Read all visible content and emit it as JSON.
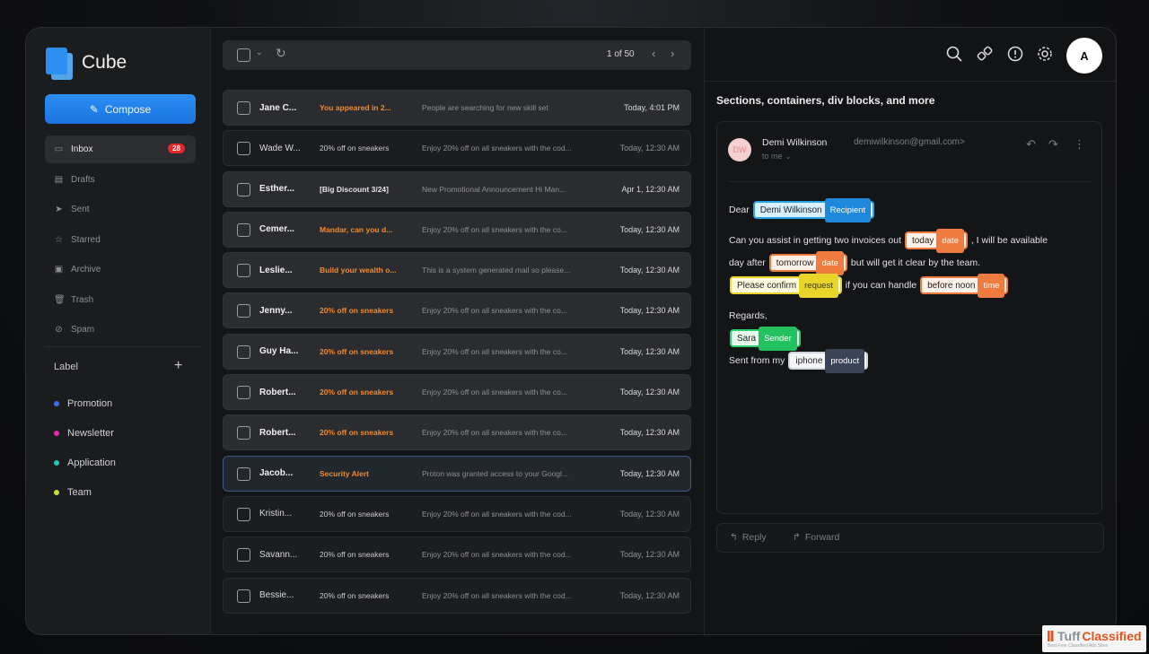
{
  "brand": {
    "name": "Cube"
  },
  "compose": {
    "label": "Compose",
    "icon": "pencil-icon"
  },
  "nav": [
    {
      "label": "Inbox",
      "icon": "inbox-icon",
      "badge": "28",
      "active": true
    },
    {
      "label": "Drafts",
      "icon": "draft-icon"
    },
    {
      "label": "Sent",
      "icon": "send-icon"
    },
    {
      "label": "Starred",
      "icon": "star-icon"
    },
    {
      "label": "Archive",
      "icon": "archive-icon"
    },
    {
      "label": "Trash",
      "icon": "trash-icon"
    },
    {
      "label": "Spam",
      "icon": "spam-icon"
    }
  ],
  "labels_section": {
    "title": "Label",
    "add": "+"
  },
  "labels": [
    {
      "label": "Promotion",
      "color": "#3b6cf0"
    },
    {
      "label": "Newsletter",
      "color": "#e52bb2"
    },
    {
      "label": "Application",
      "color": "#1fc9c0"
    },
    {
      "label": "Team",
      "color": "#c8e02b"
    }
  ],
  "toolbar": {
    "page": "1 of 50",
    "prev": "‹",
    "next": "›"
  },
  "emails": [
    {
      "from": "Jane C...",
      "subject": "You appeared in 2...",
      "preview": "People are searching for new skill set",
      "time": "Today, 4:01 PM",
      "unread": true,
      "orange": true
    },
    {
      "from": "Wade W...",
      "subject": "20% off on sneakers",
      "preview": "Enjoy 20% off on all sneakers with the cod...",
      "time": "Today, 12:30 AM",
      "unread": false,
      "orange": false
    },
    {
      "from": "Esther...",
      "subject": "[Big Discount 3/24]",
      "preview": "New Promotional Announcement Hi Man...",
      "time": "Apr 1, 12:30 AM",
      "unread": true,
      "orange": false
    },
    {
      "from": "Cemer...",
      "subject": "Mandar, can you d...",
      "preview": "Enjoy 20% off on all sneakers with the co...",
      "time": "Today, 12:30 AM",
      "unread": true,
      "orange": true
    },
    {
      "from": "Leslie...",
      "subject": "Build your wealth o...",
      "preview": "This is a system generated mail so please...",
      "time": "Today, 12:30 AM",
      "unread": true,
      "orange": true
    },
    {
      "from": "Jenny...",
      "subject": "20% off on sneakers",
      "preview": "Enjoy 20% off on all sneakers with the co...",
      "time": "Today, 12:30 AM",
      "unread": true,
      "orange": true
    },
    {
      "from": "Guy Ha...",
      "subject": "20% off on sneakers",
      "preview": "Enjoy 20% off on all sneakers with the co...",
      "time": "Today, 12:30 AM",
      "unread": true,
      "orange": true
    },
    {
      "from": "Robert...",
      "subject": "20% off on sneakers",
      "preview": "Enjoy 20% off on all sneakers with the co...",
      "time": "Today, 12:30 AM",
      "unread": true,
      "orange": true
    },
    {
      "from": "Robert...",
      "subject": "20% off on sneakers",
      "preview": "Enjoy 20% off on all sneakers with the co...",
      "time": "Today, 12:30 AM",
      "unread": true,
      "orange": true
    },
    {
      "from": "Jacob...",
      "subject": "Security Alert",
      "preview": "Proton was granted access to your Googl...",
      "time": "Today, 12:30 AM",
      "unread": true,
      "orange": true,
      "selected": true
    },
    {
      "from": "Kristin...",
      "subject": "20% off on sneakers",
      "preview": "Enjoy 20% off on all sneakers with the cod...",
      "time": "Today, 12:30 AM",
      "unread": false,
      "orange": false
    },
    {
      "from": "Savann...",
      "subject": "20% off on sneakers",
      "preview": "Enjoy 20% off on all sneakers with the cod...",
      "time": "Today, 12:30 AM",
      "unread": false,
      "orange": false
    },
    {
      "from": "Bessie...",
      "subject": "20% off on sneakers",
      "preview": "Enjoy 20% off on all sneakers with the cod...",
      "time": "Today, 12:30 AM",
      "unread": false,
      "orange": false
    }
  ],
  "reader": {
    "avatar": "A",
    "thread_title": "Sections, containers, div blocks, and more",
    "sender_initials": "DW",
    "sender_name": "Demi Wilkinson",
    "sender_email": "demiwilkinson@gmail.com>",
    "to": "to me",
    "greeting": "Dear",
    "recipient_value": "Demi Wilkinson",
    "recipient_type": "Recipient",
    "line1_a": "Can you assist in getting two invoices out",
    "date1_value": "today",
    "date1_type": "date",
    "line1_b": ", I will be available",
    "line2_a": "day after",
    "date2_value": "tomorrow",
    "date2_type": "date",
    "line2_b": "but will get it clear by the team.",
    "request_value": "Please confirm",
    "request_type": "request",
    "line3_a": "if you can handle",
    "time_value": "before noon",
    "time_type": "time",
    "regards": "Regards,",
    "sender_value": "Sara",
    "sender_type": "Sender",
    "sent_from": "Sent from my",
    "product_value": "iphone",
    "product_type": "product",
    "reply": "Reply",
    "forward": "Forward"
  },
  "watermark": {
    "main_a": "Tuff",
    "main_b": "Classified",
    "sub": "Best Free Classified Ads Sites"
  }
}
